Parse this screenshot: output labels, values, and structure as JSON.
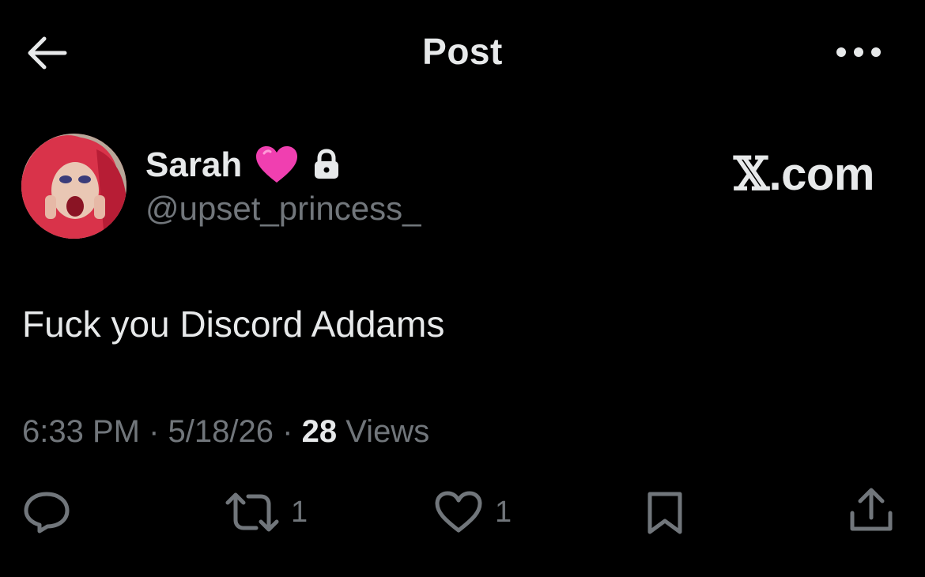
{
  "header": {
    "title": "Post"
  },
  "author": {
    "display_name": "Sarah",
    "handle": "@upset_princess_",
    "badge_icon": "pink-heart-icon",
    "protected_icon": "lock-icon"
  },
  "source": {
    "x_glyph": "𝕏",
    "domain": ".com"
  },
  "post": {
    "text": "Fuck you Discord Addams"
  },
  "meta": {
    "time": "6:33 PM",
    "date": "5/18/26",
    "views_count": "28",
    "views_label": "Views",
    "separator": "·"
  },
  "actions": {
    "reply_count": "",
    "repost_count": "1",
    "like_count": "1"
  },
  "colors": {
    "background": "#000000",
    "text_primary": "#e7e9ea",
    "text_secondary": "#71767b",
    "heart": "#f03fb0"
  }
}
